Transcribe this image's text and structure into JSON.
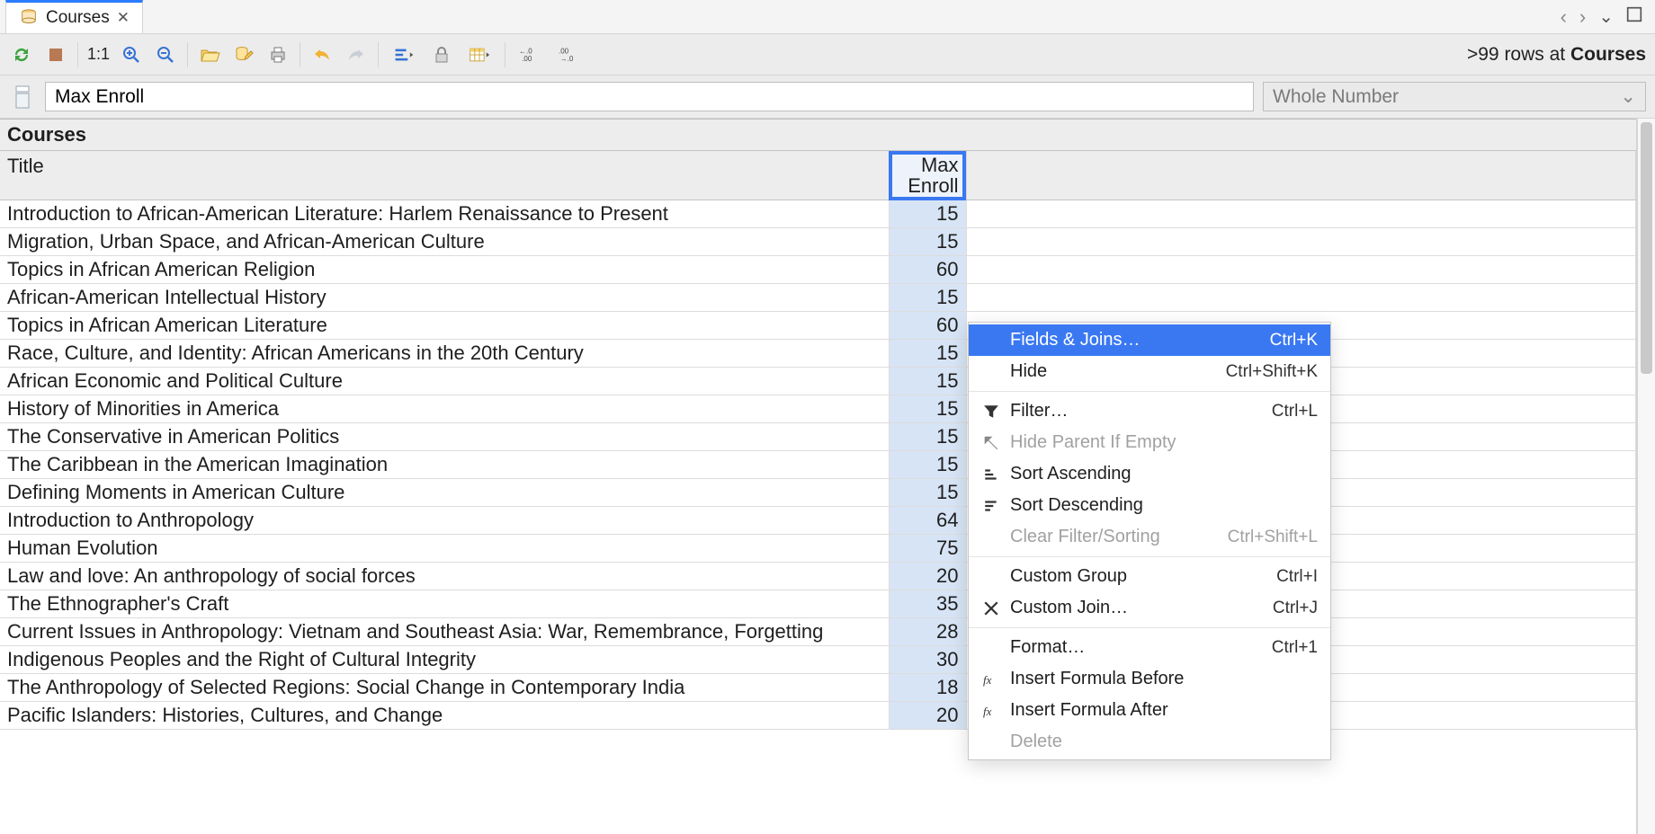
{
  "tab": {
    "title": "Courses",
    "close_glyph": "✕"
  },
  "tabstrip_controls": {
    "back": "‹",
    "forward": "›",
    "chevron": "⌄",
    "square": "▢"
  },
  "toolbar": {
    "ratio": "1:1",
    "rowcount_prefix": ">99 rows at ",
    "rowcount_target": "Courses"
  },
  "fieldbar": {
    "value": "Max Enroll",
    "type_label": "Whole Number"
  },
  "table": {
    "name": "Courses",
    "columns": {
      "title": "Title",
      "enroll": "Max Enroll"
    },
    "rows": [
      {
        "title": "Introduction to African-American Literature: Harlem Renaissance to Present",
        "enroll": 15
      },
      {
        "title": "Migration, Urban Space, and African-American Culture",
        "enroll": 15
      },
      {
        "title": "Topics in African American Religion",
        "enroll": 60
      },
      {
        "title": "African-American Intellectual History",
        "enroll": 15
      },
      {
        "title": "Topics in African American Literature",
        "enroll": 60
      },
      {
        "title": "Race, Culture, and Identity: African Americans in the 20th Century",
        "enroll": 15
      },
      {
        "title": "African Economic and Political Culture",
        "enroll": 15
      },
      {
        "title": "History of Minorities in America",
        "enroll": 15
      },
      {
        "title": "The Conservative in American Politics",
        "enroll": 15
      },
      {
        "title": "The Caribbean in the American Imagination",
        "enroll": 15
      },
      {
        "title": "Defining Moments in American Culture",
        "enroll": 15
      },
      {
        "title": "Introduction to Anthropology",
        "enroll": 64
      },
      {
        "title": "Human Evolution",
        "enroll": 75
      },
      {
        "title": "Law and love: An anthropology of social forces",
        "enroll": 20
      },
      {
        "title": "The Ethnographer's Craft",
        "enroll": 35
      },
      {
        "title": "Current Issues in Anthropology: Vietnam and Southeast Asia: War, Remembrance, Forgetting",
        "enroll": 28
      },
      {
        "title": "Indigenous Peoples and the Right of Cultural Integrity",
        "enroll": 30
      },
      {
        "title": "The Anthropology of Selected Regions: Social Change in Contemporary India",
        "enroll": 18
      },
      {
        "title": "Pacific Islanders: Histories, Cultures, and Change",
        "enroll": 20
      }
    ]
  },
  "context_menu": [
    {
      "icon": "",
      "label": "Fields & Joins…",
      "key": "Ctrl+K",
      "highlight": true
    },
    {
      "icon": "",
      "label": "Hide",
      "key": "Ctrl+Shift+K"
    },
    {
      "sep": true
    },
    {
      "icon": "filter",
      "label": "Filter…",
      "key": "Ctrl+L"
    },
    {
      "icon": "arrow-up-left",
      "label": "Hide Parent If Empty",
      "disabled": true
    },
    {
      "icon": "sort-asc",
      "label": "Sort Ascending"
    },
    {
      "icon": "sort-desc",
      "label": "Sort Descending"
    },
    {
      "icon": "",
      "label": "Clear Filter/Sorting",
      "key": "Ctrl+Shift+L",
      "disabled": true
    },
    {
      "sep": true
    },
    {
      "icon": "",
      "label": "Custom Group",
      "key": "Ctrl+I"
    },
    {
      "icon": "join",
      "label": "Custom Join…",
      "key": "Ctrl+J"
    },
    {
      "sep": true
    },
    {
      "icon": "",
      "label": "Format…",
      "key": "Ctrl+1"
    },
    {
      "icon": "fx",
      "label": "Insert Formula Before"
    },
    {
      "icon": "fx",
      "label": "Insert Formula After"
    },
    {
      "icon": "",
      "label": "Delete",
      "disabled": true
    }
  ]
}
